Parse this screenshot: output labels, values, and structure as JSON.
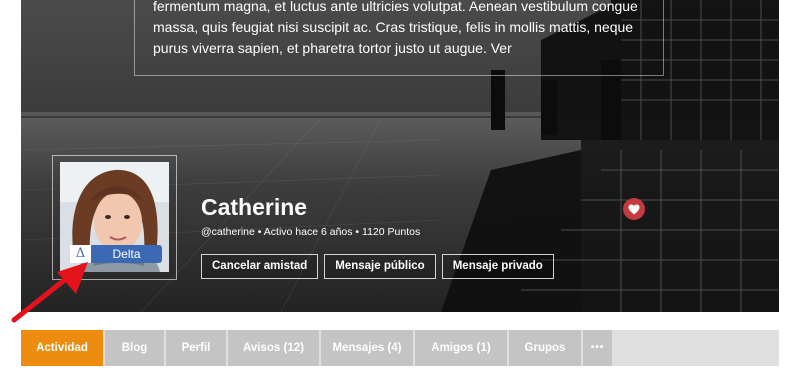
{
  "cover": {
    "quote_text": "fermentum magna, et luctus ante ultricies volutpat. Aenean vestibulum congue massa, quis feugiat nisi suscipit ac. Cras tristique, felis in mollis mattis, neque purus viverra sapien, et pharetra tortor justo ut augue. Ver"
  },
  "profile": {
    "name": "Catherine",
    "meta": "@catherine • Activo hace 6 años • 1120 Puntos",
    "badge_symbol": "Δ",
    "badge_label": "Delta"
  },
  "actions": {
    "cancel_friendship": "Cancelar amistad",
    "public_message": "Mensaje público",
    "private_message": "Mensaje privado"
  },
  "tabs": [
    {
      "label": "Actividad",
      "active": true
    },
    {
      "label": "Blog",
      "active": false
    },
    {
      "label": "Perfil",
      "active": false
    },
    {
      "label": "Avisos (12)",
      "active": false
    },
    {
      "label": "Mensajes (4)",
      "active": false
    },
    {
      "label": "Amigos (1)",
      "active": false
    },
    {
      "label": "Grupos",
      "active": false
    }
  ],
  "more_tabs_glyph": "•••",
  "colors": {
    "accent_tab": "#ee8c0f",
    "inactive_tab": "#c4c4c4",
    "badge_blue": "#3b69b3",
    "like_red": "#c43a3f",
    "arrow_red": "#e3121b"
  }
}
